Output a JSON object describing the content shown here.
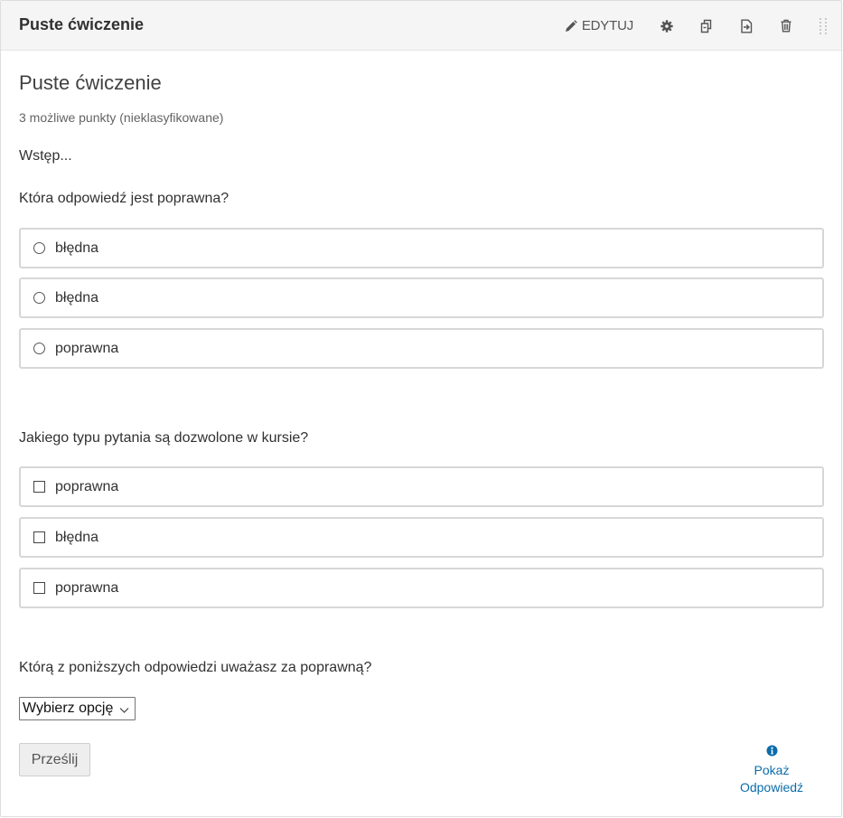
{
  "header": {
    "title": "Puste ćwiczenie",
    "edit_label": "EDYTUJ",
    "actions": [
      "pencil-icon",
      "gear-icon",
      "duplicate-icon",
      "move-icon",
      "trash-icon",
      "drag-handle-icon"
    ]
  },
  "problem": {
    "title": "Puste ćwiczenie",
    "points": "3 możliwe punkty (nieklasyfikowane)",
    "intro": "Wstęp..."
  },
  "question1": {
    "label": "Która odpowiedź jest poprawna?",
    "options": [
      "błędna",
      "błędna",
      "poprawna"
    ]
  },
  "question2": {
    "label": "Jakiego typu pytania są dozwolone w kursie?",
    "options": [
      "poprawna",
      "błędna",
      "poprawna"
    ]
  },
  "question3": {
    "label": "Którą z poniższych odpowiedzi uważasz za poprawną?",
    "select_value": "Wybierz opcję"
  },
  "footer": {
    "submit_label": "Prześlij",
    "show_answer_line1": "Pokaż",
    "show_answer_line2": "Odpowiedź"
  },
  "colors": {
    "header_bg": "#f5f5f5",
    "link": "#0a6caa",
    "option_border": "#d7d7d7",
    "submit_bg": "#eeeeee"
  }
}
